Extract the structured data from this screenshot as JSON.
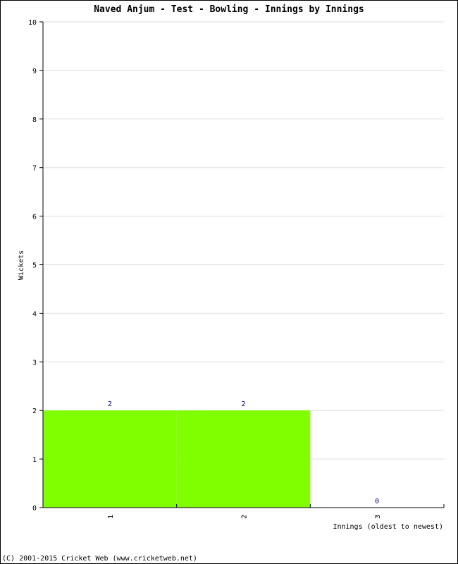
{
  "chart_data": {
    "type": "bar",
    "title": "Naved Anjum - Test - Bowling - Innings by Innings",
    "xlabel": "Innings (oldest to newest)",
    "ylabel": "Wickets",
    "categories": [
      "1",
      "2",
      "3"
    ],
    "values": [
      2,
      2,
      0
    ],
    "data_labels": [
      "2",
      "2",
      "0"
    ],
    "ylim": [
      0,
      10
    ],
    "yticks": [
      0,
      1,
      2,
      3,
      4,
      5,
      6,
      7,
      8,
      9,
      10
    ],
    "grid": true,
    "bar_color": "#80ff00",
    "label_color": "#000080",
    "grid_color": "#dddddd"
  },
  "footer": "(C) 2001-2015 Cricket Web (www.cricketweb.net)"
}
